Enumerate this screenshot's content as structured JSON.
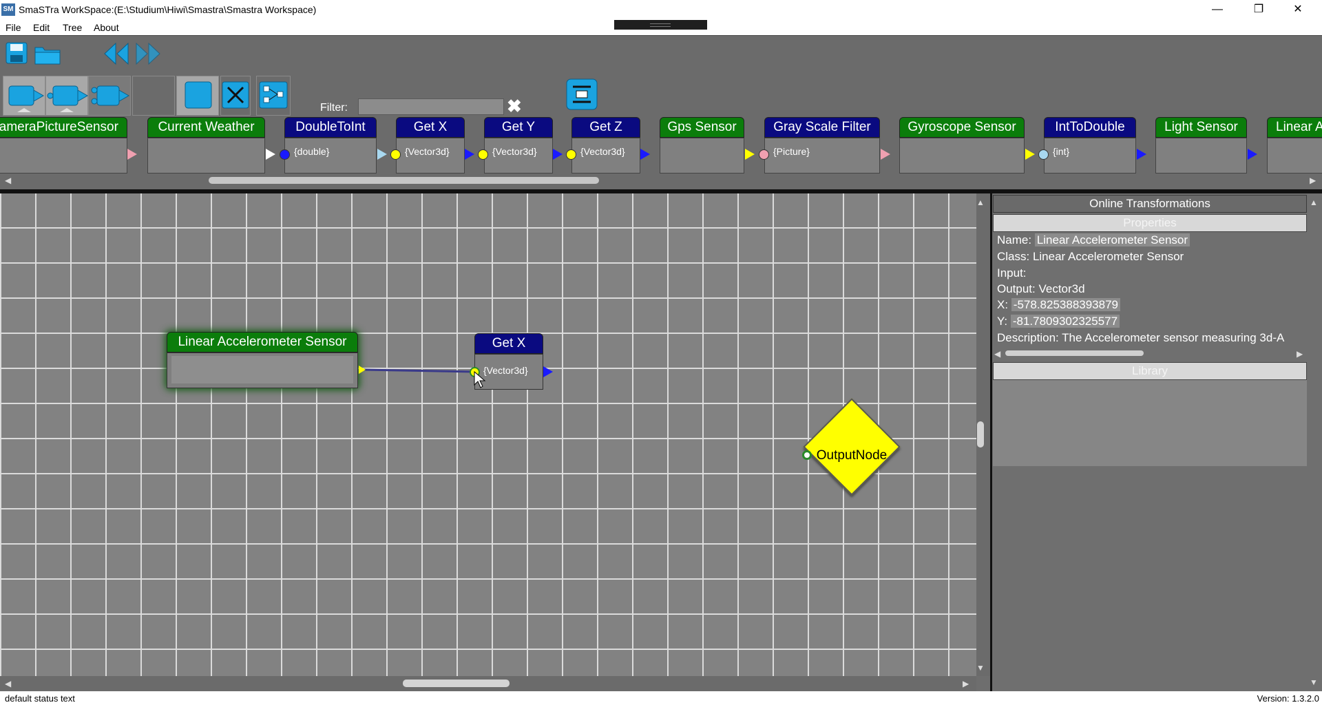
{
  "window": {
    "icon_text": "SM",
    "title": "SmaSTra   WorkSpace:(E:\\Studium\\Hiwi\\Smastra\\Smastra Workspace)",
    "minimize": "—",
    "maximize": "❐",
    "close": "✕"
  },
  "menu": [
    "File",
    "Edit",
    "Tree",
    "About"
  ],
  "toolbar": {
    "filter_label": "Filter:",
    "filter_value": "",
    "filter_clear": "✖"
  },
  "palette": [
    {
      "label": "CameraPictureSensor",
      "color": "green",
      "type": ""
    },
    {
      "label": "Current Weather",
      "color": "green",
      "type": ""
    },
    {
      "label": "DoubleToInt",
      "color": "blue",
      "type": "{double}"
    },
    {
      "label": "Get X",
      "color": "blue",
      "type": "{Vector3d}"
    },
    {
      "label": "Get Y",
      "color": "blue",
      "type": "{Vector3d}"
    },
    {
      "label": "Get Z",
      "color": "blue",
      "type": "{Vector3d}"
    },
    {
      "label": "Gps Sensor",
      "color": "green",
      "type": ""
    },
    {
      "label": "Gray Scale Filter",
      "color": "blue",
      "type": "{Picture}"
    },
    {
      "label": "Gyroscope Sensor",
      "color": "green",
      "type": ""
    },
    {
      "label": "IntToDouble",
      "color": "blue",
      "type": "{int}"
    },
    {
      "label": "Light Sensor",
      "color": "green",
      "type": ""
    },
    {
      "label": "Linear Accelerometer Sensor",
      "color": "green",
      "type": ""
    }
  ],
  "canvas": {
    "nodes": {
      "sensor": {
        "label": "Linear Accelerometer Sensor"
      },
      "getx": {
        "label": "Get X",
        "type": "{Vector3d}"
      },
      "output": {
        "label": "OutputNode"
      }
    }
  },
  "panel": {
    "title": "Online Transformations",
    "properties_header": "Properties",
    "name_label": "Name:",
    "name_value": "Linear Accelerometer Sensor",
    "class_line": "Class: Linear Accelerometer Sensor",
    "input_line": "Input:",
    "output_line": "Output: Vector3d",
    "x_label": "X:",
    "x_value": "-578.825388393879",
    "y_label": "Y:",
    "y_value": "-81.7809302325577",
    "description_line": "Description: The Accelerometer sensor measuring 3d-A",
    "library_header": "Library"
  },
  "status": {
    "text": "default status text",
    "version": "Version: 1.3.2.0"
  },
  "colors": {
    "green_node": "#0b7d0b",
    "blue_node": "#0a0a80",
    "output_node": "#ffff00",
    "pin_blue": "#1a1aff",
    "pin_yellow": "#ffff00",
    "pin_pink": "#f0a0b0",
    "pin_lightblue": "#a8d8f0"
  }
}
